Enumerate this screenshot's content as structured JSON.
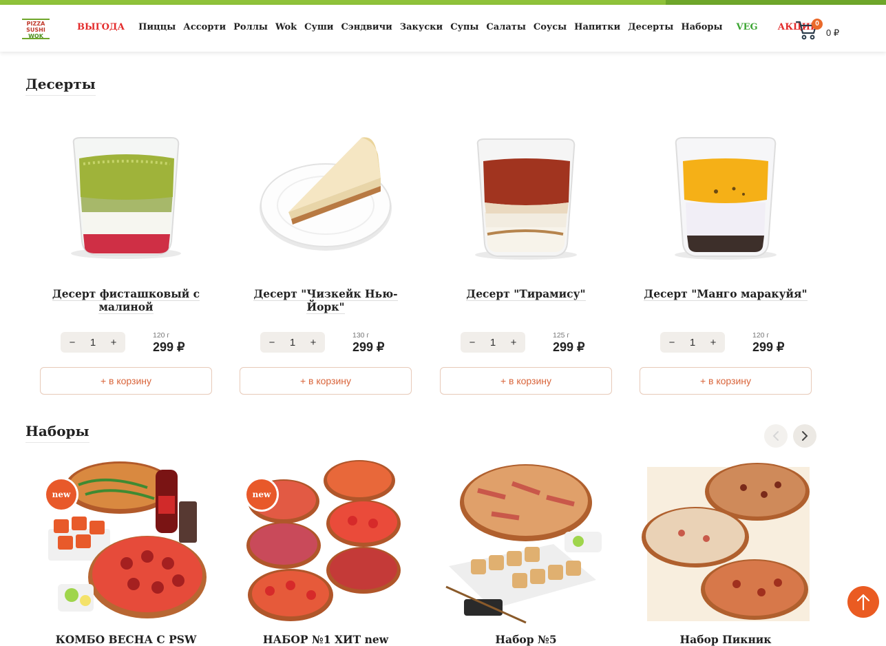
{
  "header": {
    "logo": [
      "PIZZA",
      "SUSHI",
      "WOK"
    ],
    "nav": [
      {
        "label": "ВЫГОДА",
        "style": "red"
      },
      {
        "label": "Пиццы",
        "style": ""
      },
      {
        "label": "Ассорти",
        "style": ""
      },
      {
        "label": "Роллы",
        "style": ""
      },
      {
        "label": "Wok",
        "style": ""
      },
      {
        "label": "Суши",
        "style": ""
      },
      {
        "label": "Сэндвичи",
        "style": ""
      },
      {
        "label": "Закуски",
        "style": ""
      },
      {
        "label": "Супы",
        "style": ""
      },
      {
        "label": "Салаты",
        "style": ""
      },
      {
        "label": "Соусы",
        "style": ""
      },
      {
        "label": "Напитки",
        "style": ""
      },
      {
        "label": "Десерты",
        "style": ""
      },
      {
        "label": "Наборы",
        "style": ""
      },
      {
        "label": "VEG",
        "style": "green"
      },
      {
        "label": "АКЦИИ",
        "style": "red"
      }
    ],
    "cart": {
      "count": "0",
      "total": "0 ₽"
    }
  },
  "desserts": {
    "title": "Десерты",
    "products": [
      {
        "name": "Десерт фисташковый с малиной",
        "weight": "120 г",
        "price": "299 ₽",
        "qty": "1",
        "add_label": "+ в корзину",
        "minus": "−",
        "plus": "+"
      },
      {
        "name": "Десерт \"Чизкейк Нью-Йорк\"",
        "weight": "130 г",
        "price": "299 ₽",
        "qty": "1",
        "add_label": "+ в корзину",
        "minus": "−",
        "plus": "+"
      },
      {
        "name": "Десерт \"Тирамису\"",
        "weight": "125 г",
        "price": "299 ₽",
        "qty": "1",
        "add_label": "+ в корзину",
        "minus": "−",
        "plus": "+"
      },
      {
        "name": "Десерт \"Манго маракуйя\"",
        "weight": "120 г",
        "price": "299 ₽",
        "qty": "1",
        "add_label": "+ в корзину",
        "minus": "−",
        "plus": "+"
      }
    ]
  },
  "sets": {
    "title": "Наборы",
    "new_badge": "new",
    "products": [
      {
        "name": "КОМБО ВЕСНА С PSW"
      },
      {
        "name": "НАБОР №1 ХИТ new"
      },
      {
        "name": "Набор №5"
      },
      {
        "name": "Набор Пикник"
      }
    ]
  },
  "colors": {
    "accent": "#ea5b22",
    "brand_green": "#6ea62a",
    "promo_red": "#e32b2b",
    "veg_green": "#3ca533"
  }
}
